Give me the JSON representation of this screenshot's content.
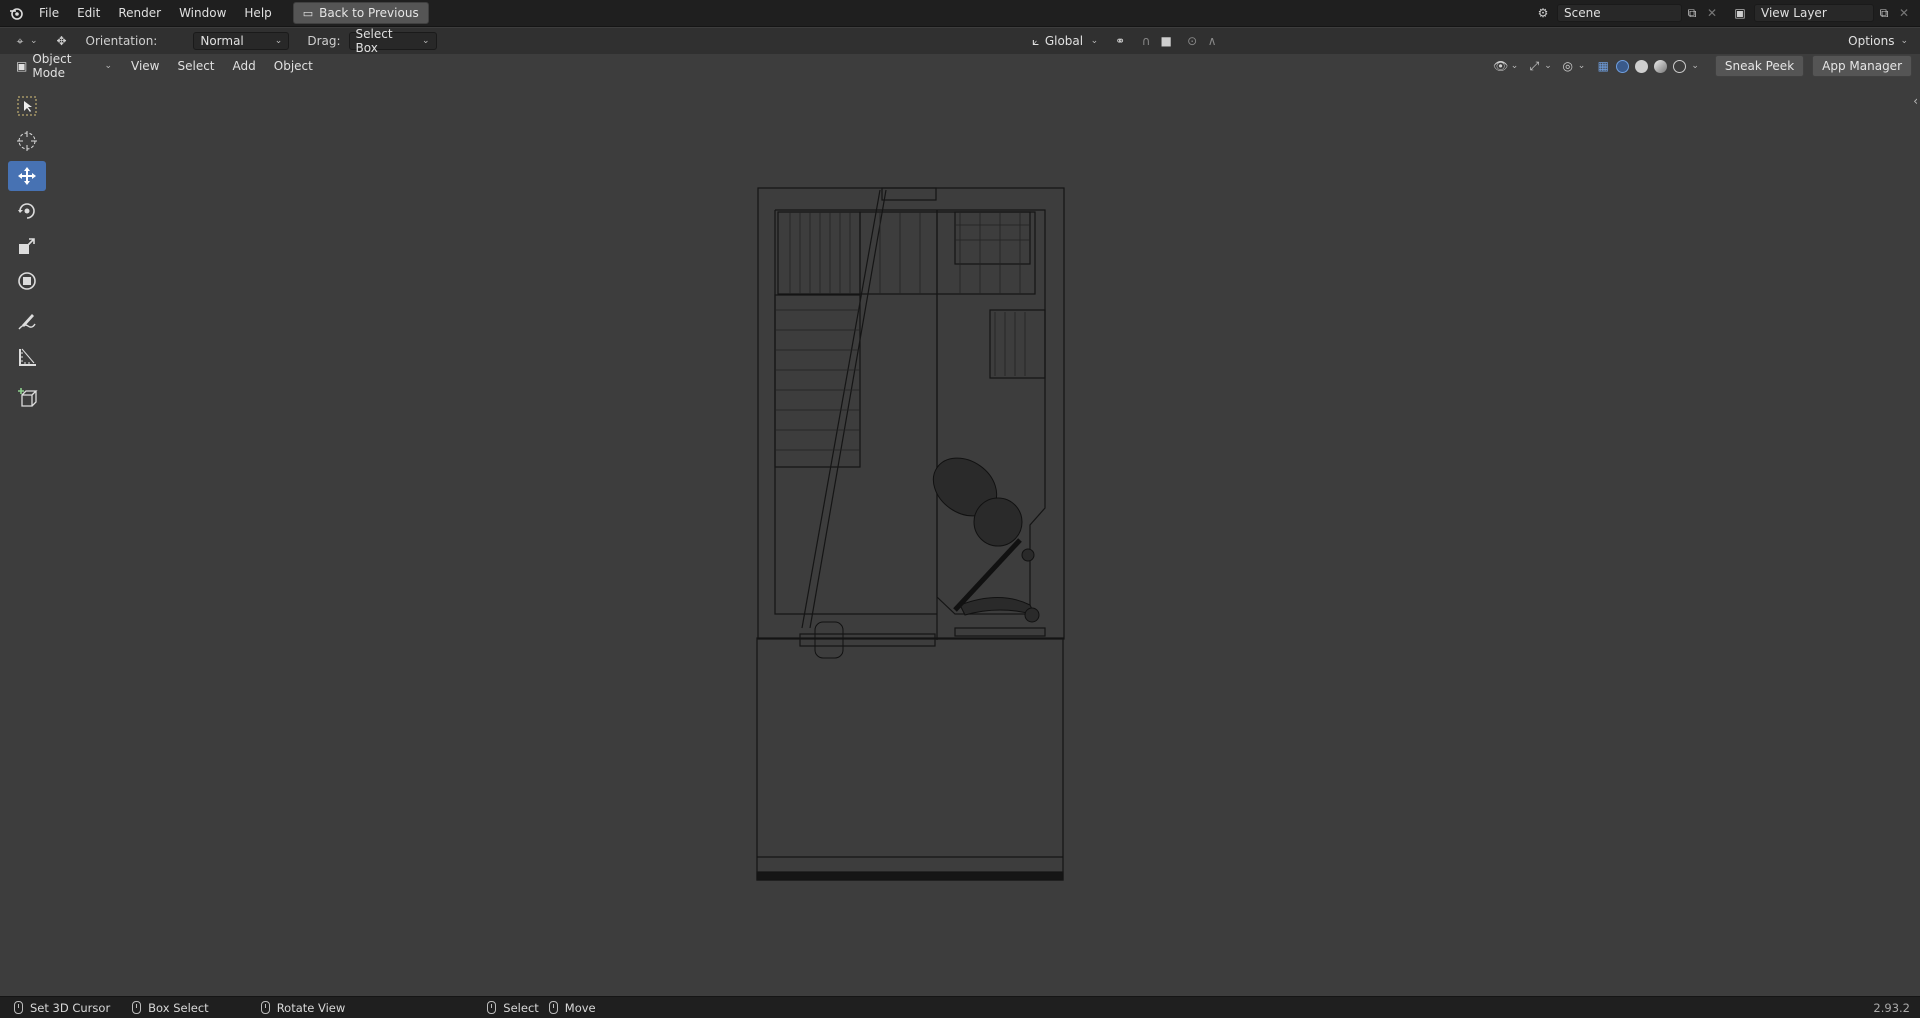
{
  "topbar": {
    "menus": [
      "File",
      "Edit",
      "Render",
      "Window",
      "Help"
    ],
    "back_button": "Back to Previous",
    "scene": "Scene",
    "view_layer": "View Layer"
  },
  "tool_header": {
    "orientation_label": "Orientation:",
    "orientation_value": "Normal",
    "drag_label": "Drag:",
    "drag_value": "Select Box",
    "transform_orientation": "Global",
    "options": "Options"
  },
  "view_header": {
    "mode": "Object Mode",
    "menus": [
      "View",
      "Select",
      "Add",
      "Object"
    ],
    "sneak_peek": "Sneak Peek",
    "app_manager": "App Manager"
  },
  "toolbar": {
    "tools": [
      "select-box-icon",
      "cursor-icon",
      "move-icon",
      "rotate-icon",
      "scale-icon",
      "transform-icon",
      "annotate-icon",
      "measure-icon",
      "add-cube-icon"
    ],
    "active": "move-icon"
  },
  "statusbar": {
    "set_cursor": "Set 3D Cursor",
    "box_select": "Box Select",
    "rotate_view": "Rotate View",
    "select": "Select",
    "move": "Move",
    "version": "2.93.2"
  },
  "colors": {
    "accent": "#4772b3",
    "viewport_bg": "#3d3d3d",
    "header_bg": "#1f1f1f"
  }
}
